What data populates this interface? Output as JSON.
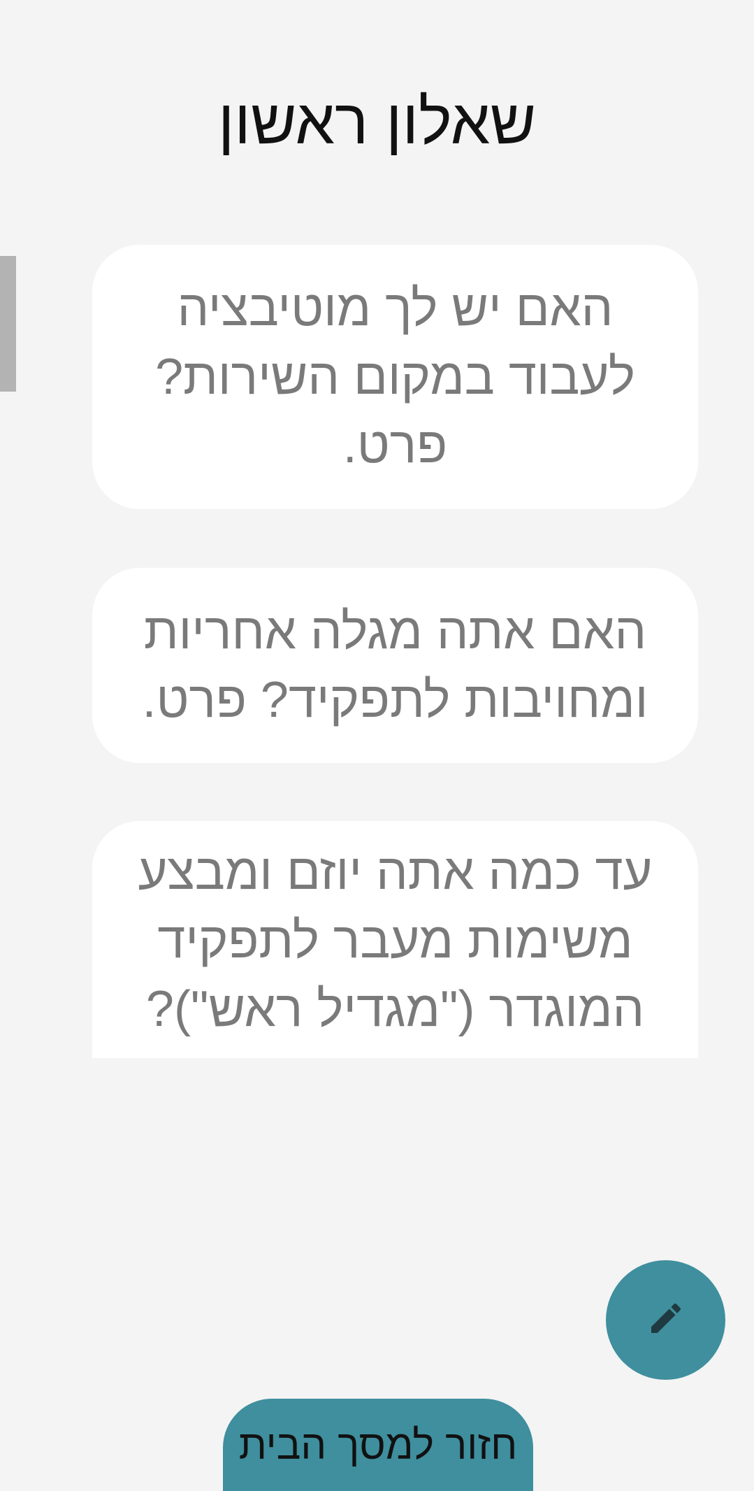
{
  "header": {
    "title": "שאלון ראשון"
  },
  "questions": [
    {
      "text": "האם יש לך מוטיבציה לעבוד במקום השירות? פרט."
    },
    {
      "text": "האם אתה מגלה אחריות ומחויבות לתפקיד? פרט."
    },
    {
      "text": "עד כמה אתה יוזם ומבצע משימות מעבר לתפקיד המוגדר (\"מגדיל ראש\")?"
    }
  ],
  "fab": {
    "icon": "pencil-icon",
    "color": "#3f8f9e"
  },
  "footer": {
    "home_button_label": "חזור למסך הבית"
  }
}
